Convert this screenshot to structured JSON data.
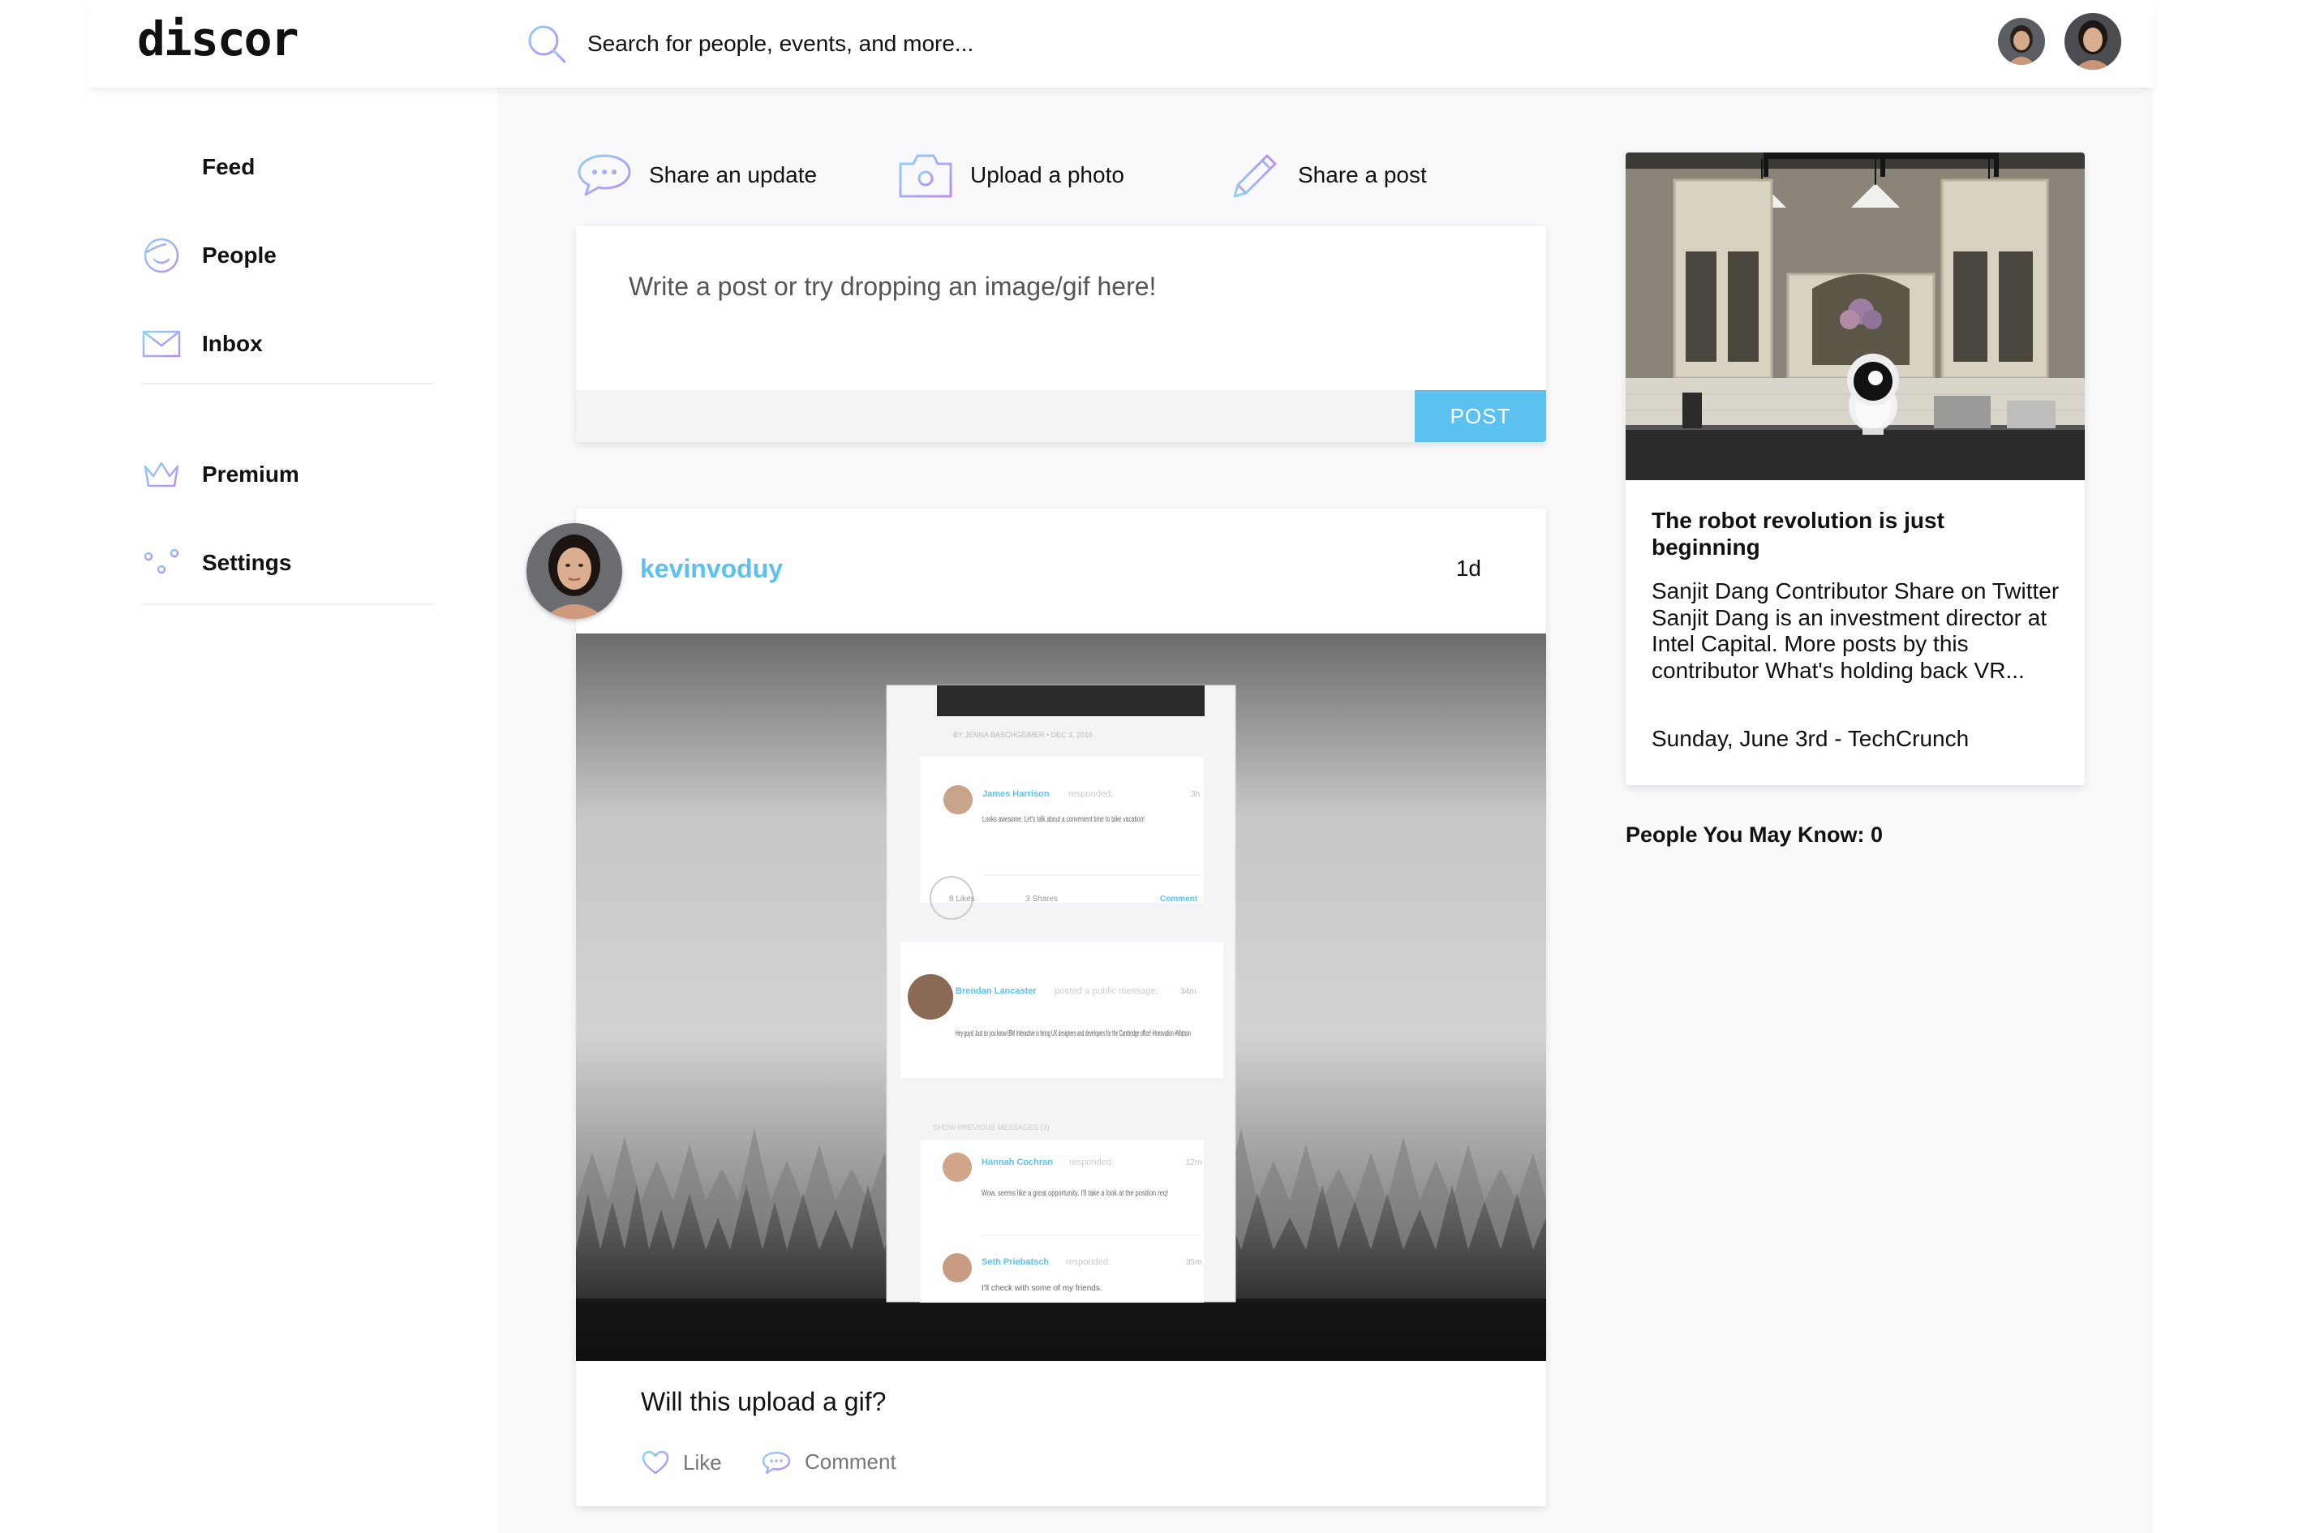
{
  "app": {
    "logo": "discor",
    "accent_color": "#5bc2f0",
    "icon_gradient": [
      "#8fd3f4",
      "#b98cf5"
    ]
  },
  "header": {
    "search": {
      "placeholder": "Search for people, events, and more...",
      "icon": "search-icon"
    },
    "avatars": [
      "user-avatar",
      "profile-avatar"
    ]
  },
  "sidebar": {
    "items": [
      {
        "label": "Feed",
        "icon": "list-icon"
      },
      {
        "label": "People",
        "icon": "smiley-face-icon"
      },
      {
        "label": "Inbox",
        "icon": "envelope-icon"
      },
      {
        "label": "Premium",
        "icon": "crown-icon"
      },
      {
        "label": "Settings",
        "icon": "sliders-icon"
      }
    ]
  },
  "share_actions": [
    {
      "label": "Share an update",
      "icon": "speech-bubble-icon"
    },
    {
      "label": "Upload a photo",
      "icon": "camera-icon"
    },
    {
      "label": "Share a post",
      "icon": "pencil-icon"
    }
  ],
  "composer": {
    "placeholder": "Write a post or try dropping an image/gif here!",
    "post_label": "POST"
  },
  "post": {
    "author": "kevinvoduy",
    "time": "1d",
    "caption": "Will this upload a gif?",
    "actions": {
      "like": "Like",
      "comment": "Comment"
    },
    "image_mock": {
      "byline": "BY JENNA BASCHGEIMER  •  DEC 3, 2016",
      "messages": [
        {
          "name": "James Harrison",
          "action": "responded:",
          "time": "3h",
          "text": "Looks awesome. Let's talk about a convenient time to take vacation!"
        },
        {
          "name": "Brendan Lancaster",
          "action": "posted a public message:",
          "time": "34m",
          "text": "Hey guys! Just so you know IBM Interactive is hiring UX designers and developers for the Cambridge office! #Innovation #Watson"
        },
        {
          "name": "Hannah Cochran",
          "action": "responded:",
          "time": "12m",
          "text": "Wow, seems like a great opportunity. I'll take a look at the position req!"
        },
        {
          "name": "Seth Priebatsch",
          "action": "responded:",
          "time": "35m",
          "text": "I'll check with some of my friends."
        }
      ],
      "likes": "8 Likes",
      "shares": "3 Shares",
      "comment": "Comment",
      "show_previous": "SHOW PREVIOUS MESSAGES (3)"
    }
  },
  "news": {
    "title": "The robot revolution is just beginning",
    "body": "Sanjit Dang Contributor Share on Twitter Sanjit Dang is an investment director at Intel Capital. More posts by this contributor What's holding back VR...",
    "date": "Sunday, June 3rd - TechCrunch"
  },
  "people_you_may_know": "People You May Know: 0"
}
